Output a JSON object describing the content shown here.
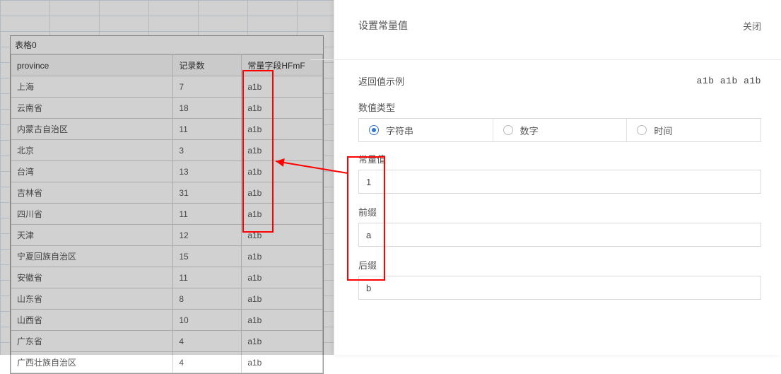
{
  "table": {
    "title": "表格0",
    "columns": [
      "province",
      "记录数",
      "常量字段HFmF"
    ],
    "rows": [
      {
        "province": "上海",
        "count": "7",
        "constv": "a1b"
      },
      {
        "province": "云南省",
        "count": "18",
        "constv": "a1b"
      },
      {
        "province": "内蒙古自治区",
        "count": "11",
        "constv": "a1b"
      },
      {
        "province": "北京",
        "count": "3",
        "constv": "a1b"
      },
      {
        "province": "台湾",
        "count": "13",
        "constv": "a1b"
      },
      {
        "province": "吉林省",
        "count": "31",
        "constv": "a1b"
      },
      {
        "province": "四川省",
        "count": "11",
        "constv": "a1b"
      },
      {
        "province": "天津",
        "count": "12",
        "constv": "a1b"
      },
      {
        "province": "宁夏回族自治区",
        "count": "15",
        "constv": "a1b"
      },
      {
        "province": "安徽省",
        "count": "11",
        "constv": "a1b"
      },
      {
        "province": "山东省",
        "count": "8",
        "constv": "a1b"
      },
      {
        "province": "山西省",
        "count": "10",
        "constv": "a1b"
      },
      {
        "province": "广东省",
        "count": "4",
        "constv": "a1b"
      },
      {
        "province": "广西壮族自治区",
        "count": "4",
        "constv": "a1b"
      }
    ]
  },
  "panel": {
    "title": "设置常量值",
    "close_label": "关闭",
    "example_label": "返回值示例",
    "example_value": "a1b a1b a1b",
    "type_label": "数值类型",
    "type_options": {
      "string": "字符串",
      "number": "数字",
      "time": "时间"
    },
    "type_selected": "string",
    "const_label": "常量值",
    "const_value": "1",
    "prefix_label": "前缀",
    "prefix_value": "a",
    "suffix_label": "后缀",
    "suffix_value": "b"
  },
  "annotation": {
    "color": "#ff0000"
  }
}
